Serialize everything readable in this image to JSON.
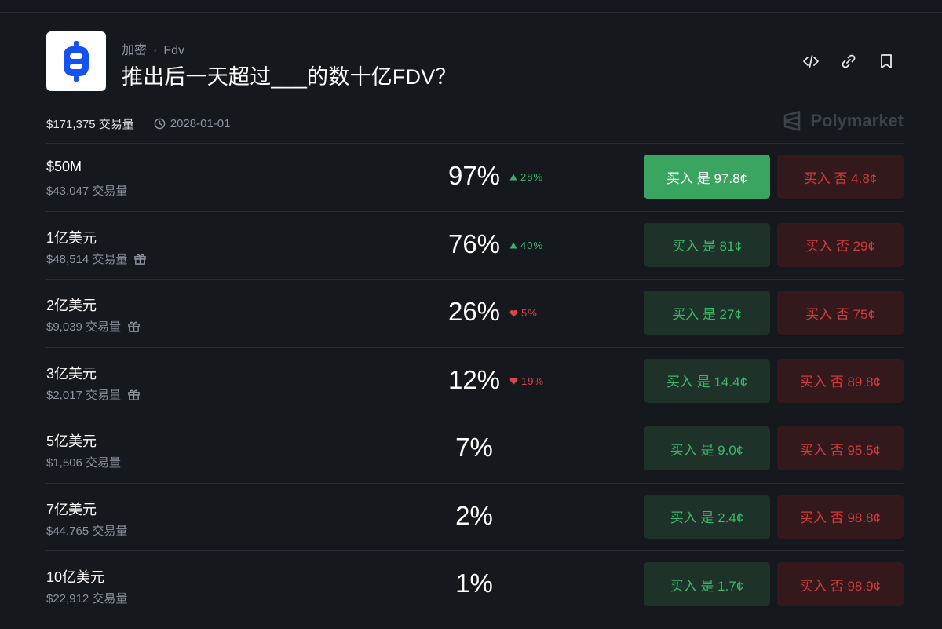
{
  "market": {
    "category": "加密",
    "subcategory": "Fdv",
    "title": "推出后一天超过___的数十亿FDV？",
    "volume": "$171,375 交易量",
    "date": "2028-01-01",
    "brand": "Polymarket"
  },
  "icons": {
    "logo": "b-coin-logo",
    "embed": "code-icon",
    "link": "link-icon",
    "bookmark": "bookmark-icon",
    "clock": "clock-icon",
    "gift": "gift-icon",
    "brand": "polymarket-logo"
  },
  "colors": {
    "background": "#15181d",
    "yes_accent": "#3aa561",
    "yes_text": "#39b86b",
    "no_text": "#d33a3f",
    "up": "#35b56c",
    "down": "#d9444a",
    "logo_blue": "#1652f0"
  },
  "outcomes": [
    {
      "name": "$50M",
      "volume": "$43,047 交易量",
      "gift": false,
      "percent": "97%",
      "change": "28%",
      "direction": "up",
      "yes": "买入 是 97.8¢",
      "no": "买入 否 4.8¢",
      "yes_active": true
    },
    {
      "name": "1亿美元",
      "volume": "$48,514 交易量",
      "gift": true,
      "percent": "76%",
      "change": "40%",
      "direction": "up",
      "yes": "买入 是 81¢",
      "no": "买入 否 29¢",
      "yes_active": false
    },
    {
      "name": "2亿美元",
      "volume": "$9,039 交易量",
      "gift": true,
      "percent": "26%",
      "change": "5%",
      "direction": "down",
      "yes": "买入 是 27¢",
      "no": "买入 否 75¢",
      "yes_active": false
    },
    {
      "name": "3亿美元",
      "volume": "$2,017 交易量",
      "gift": true,
      "percent": "12%",
      "change": "19%",
      "direction": "down",
      "yes": "买入 是 14.4¢",
      "no": "买入 否 89.8¢",
      "yes_active": false
    },
    {
      "name": "5亿美元",
      "volume": "$1,506 交易量",
      "gift": false,
      "percent": "7%",
      "change": "",
      "direction": "",
      "yes": "买入 是 9.0¢",
      "no": "买入 否 95.5¢",
      "yes_active": false
    },
    {
      "name": "7亿美元",
      "volume": "$44,765 交易量",
      "gift": false,
      "percent": "2%",
      "change": "",
      "direction": "",
      "yes": "买入 是 2.4¢",
      "no": "买入 否 98.8¢",
      "yes_active": false
    },
    {
      "name": "10亿美元",
      "volume": "$22,912 交易量",
      "gift": false,
      "percent": "1%",
      "change": "",
      "direction": "",
      "yes": "买入 是 1.7¢",
      "no": "买入 否 98.9¢",
      "yes_active": false
    }
  ]
}
